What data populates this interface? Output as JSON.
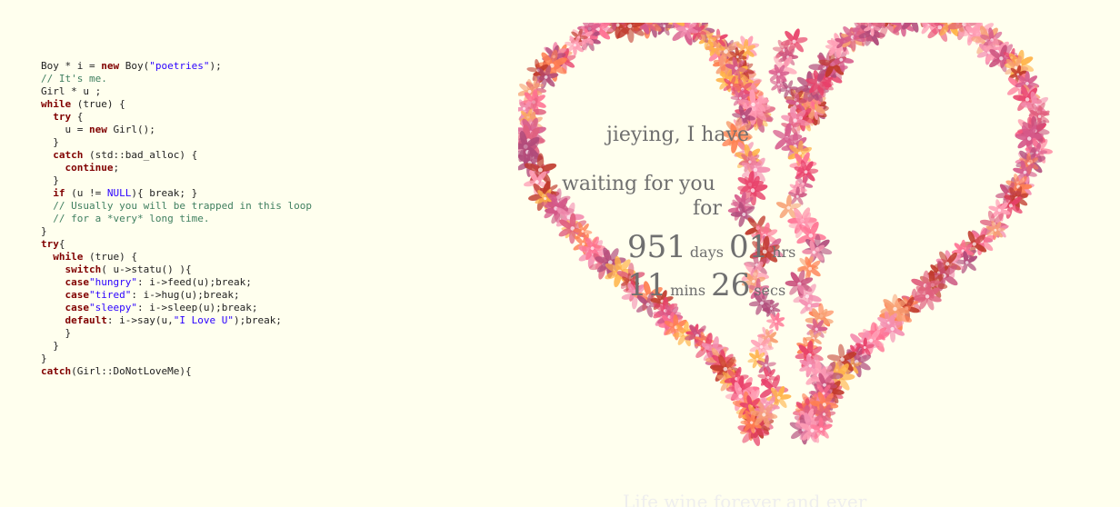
{
  "code_lines": [
    [
      {
        "t": "tx",
        "s": "Boy * i = "
      },
      {
        "t": "kw",
        "s": "new"
      },
      {
        "t": "tx",
        "s": " Boy("
      },
      {
        "t": "str",
        "s": "\"poetries\""
      },
      {
        "t": "tx",
        "s": ");"
      }
    ],
    [
      {
        "t": "cm",
        "s": "// It's me."
      }
    ],
    [
      {
        "t": "tx",
        "s": "Girl * u ;"
      }
    ],
    [
      {
        "t": "kw",
        "s": "while"
      },
      {
        "t": "tx",
        "s": " (true) {"
      }
    ],
    [
      {
        "t": "tx",
        "s": "  "
      },
      {
        "t": "kw",
        "s": "try"
      },
      {
        "t": "tx",
        "s": " {"
      }
    ],
    [
      {
        "t": "tx",
        "s": "    u = "
      },
      {
        "t": "kw",
        "s": "new"
      },
      {
        "t": "tx",
        "s": " Girl();"
      }
    ],
    [
      {
        "t": "tx",
        "s": "  }"
      }
    ],
    [
      {
        "t": "tx",
        "s": "  "
      },
      {
        "t": "kw",
        "s": "catch"
      },
      {
        "t": "tx",
        "s": " (std::bad_alloc) {"
      }
    ],
    [
      {
        "t": "tx",
        "s": "    "
      },
      {
        "t": "kw",
        "s": "continue"
      },
      {
        "t": "tx",
        "s": ";"
      }
    ],
    [
      {
        "t": "tx",
        "s": "  }"
      }
    ],
    [
      {
        "t": "tx",
        "s": "  "
      },
      {
        "t": "kw",
        "s": "if"
      },
      {
        "t": "tx",
        "s": " (u != "
      },
      {
        "t": "const",
        "s": "NULL"
      },
      {
        "t": "tx",
        "s": "){ break; }"
      }
    ],
    [
      {
        "t": "tx",
        "s": "  "
      },
      {
        "t": "cm",
        "s": "// Usually you will be trapped in this loop"
      }
    ],
    [
      {
        "t": "tx",
        "s": "  "
      },
      {
        "t": "cm",
        "s": "// for a *very* long time."
      }
    ],
    [
      {
        "t": "tx",
        "s": "}"
      }
    ],
    [
      {
        "t": "kw",
        "s": "try"
      },
      {
        "t": "tx",
        "s": "{"
      }
    ],
    [
      {
        "t": "tx",
        "s": "  "
      },
      {
        "t": "kw",
        "s": "while"
      },
      {
        "t": "tx",
        "s": " (true) {"
      }
    ],
    [
      {
        "t": "tx",
        "s": "    "
      },
      {
        "t": "kw",
        "s": "switch"
      },
      {
        "t": "tx",
        "s": "( u->statu() ){"
      }
    ],
    [
      {
        "t": "tx",
        "s": "    "
      },
      {
        "t": "kw",
        "s": "case"
      },
      {
        "t": "str",
        "s": "\"hungry\""
      },
      {
        "t": "tx",
        "s": ": i->feed(u);break;"
      }
    ],
    [
      {
        "t": "tx",
        "s": "    "
      },
      {
        "t": "kw",
        "s": "case"
      },
      {
        "t": "str",
        "s": "\"tired\""
      },
      {
        "t": "tx",
        "s": ": i->hug(u);break;"
      }
    ],
    [
      {
        "t": "tx",
        "s": "    "
      },
      {
        "t": "kw",
        "s": "case"
      },
      {
        "t": "str",
        "s": "\"sleepy\""
      },
      {
        "t": "tx",
        "s": ": i->sleep(u);break;"
      }
    ],
    [
      {
        "t": "tx",
        "s": "    "
      },
      {
        "t": "kw",
        "s": "default"
      },
      {
        "t": "tx",
        "s": ": i->say(u,"
      },
      {
        "t": "str",
        "s": "\"I Love U\""
      },
      {
        "t": "tx",
        "s": ");break;"
      }
    ],
    [
      {
        "t": "tx",
        "s": "    }"
      }
    ],
    [
      {
        "t": "tx",
        "s": "  }"
      }
    ],
    [
      {
        "t": "tx",
        "s": "}"
      }
    ],
    [
      {
        "t": "kw",
        "s": "catch"
      },
      {
        "t": "tx",
        "s": "(Girl::DoNotLoveMe){"
      }
    ]
  ],
  "message": {
    "line1": "jieying, I have",
    "line2": "waiting for you",
    "line3": "for"
  },
  "timer": {
    "days_value": "951",
    "days_unit": "days",
    "hours_value": "01",
    "hours_unit": "hrs",
    "mins_value": "11",
    "mins_unit": "mins",
    "secs_value": "26",
    "secs_unit": "secs"
  },
  "footer": {
    "text": "Life wine forever and ever"
  },
  "colors": {
    "background": "#ffffee",
    "flower_palette": [
      "#e8416a",
      "#ff6f91",
      "#f7a072",
      "#c94f7c",
      "#ff9eb5",
      "#e0607e",
      "#d65a8b",
      "#ff7f50",
      "#c0392b",
      "#f48fb1",
      "#ffb347",
      "#b04a7a"
    ]
  }
}
